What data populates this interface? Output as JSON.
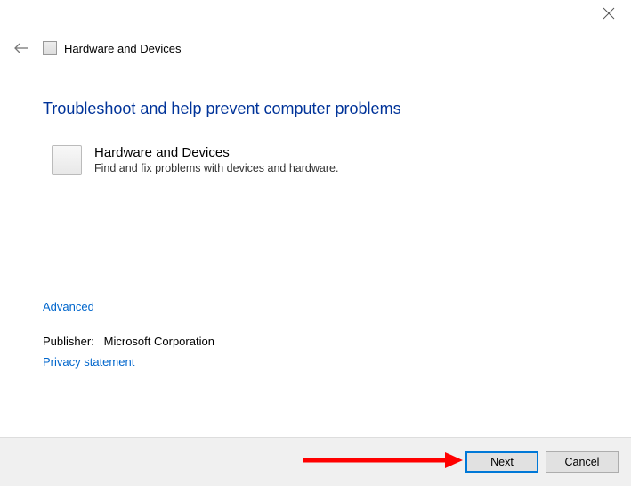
{
  "window": {
    "title": "Hardware and Devices"
  },
  "main": {
    "headline": "Troubleshoot and help prevent computer problems",
    "item": {
      "title": "Hardware and Devices",
      "description": "Find and fix problems with devices and hardware."
    },
    "advanced_link": "Advanced",
    "publisher_label": "Publisher:",
    "publisher_value": "Microsoft Corporation",
    "privacy_link": "Privacy statement"
  },
  "footer": {
    "next": "Next",
    "cancel": "Cancel"
  }
}
